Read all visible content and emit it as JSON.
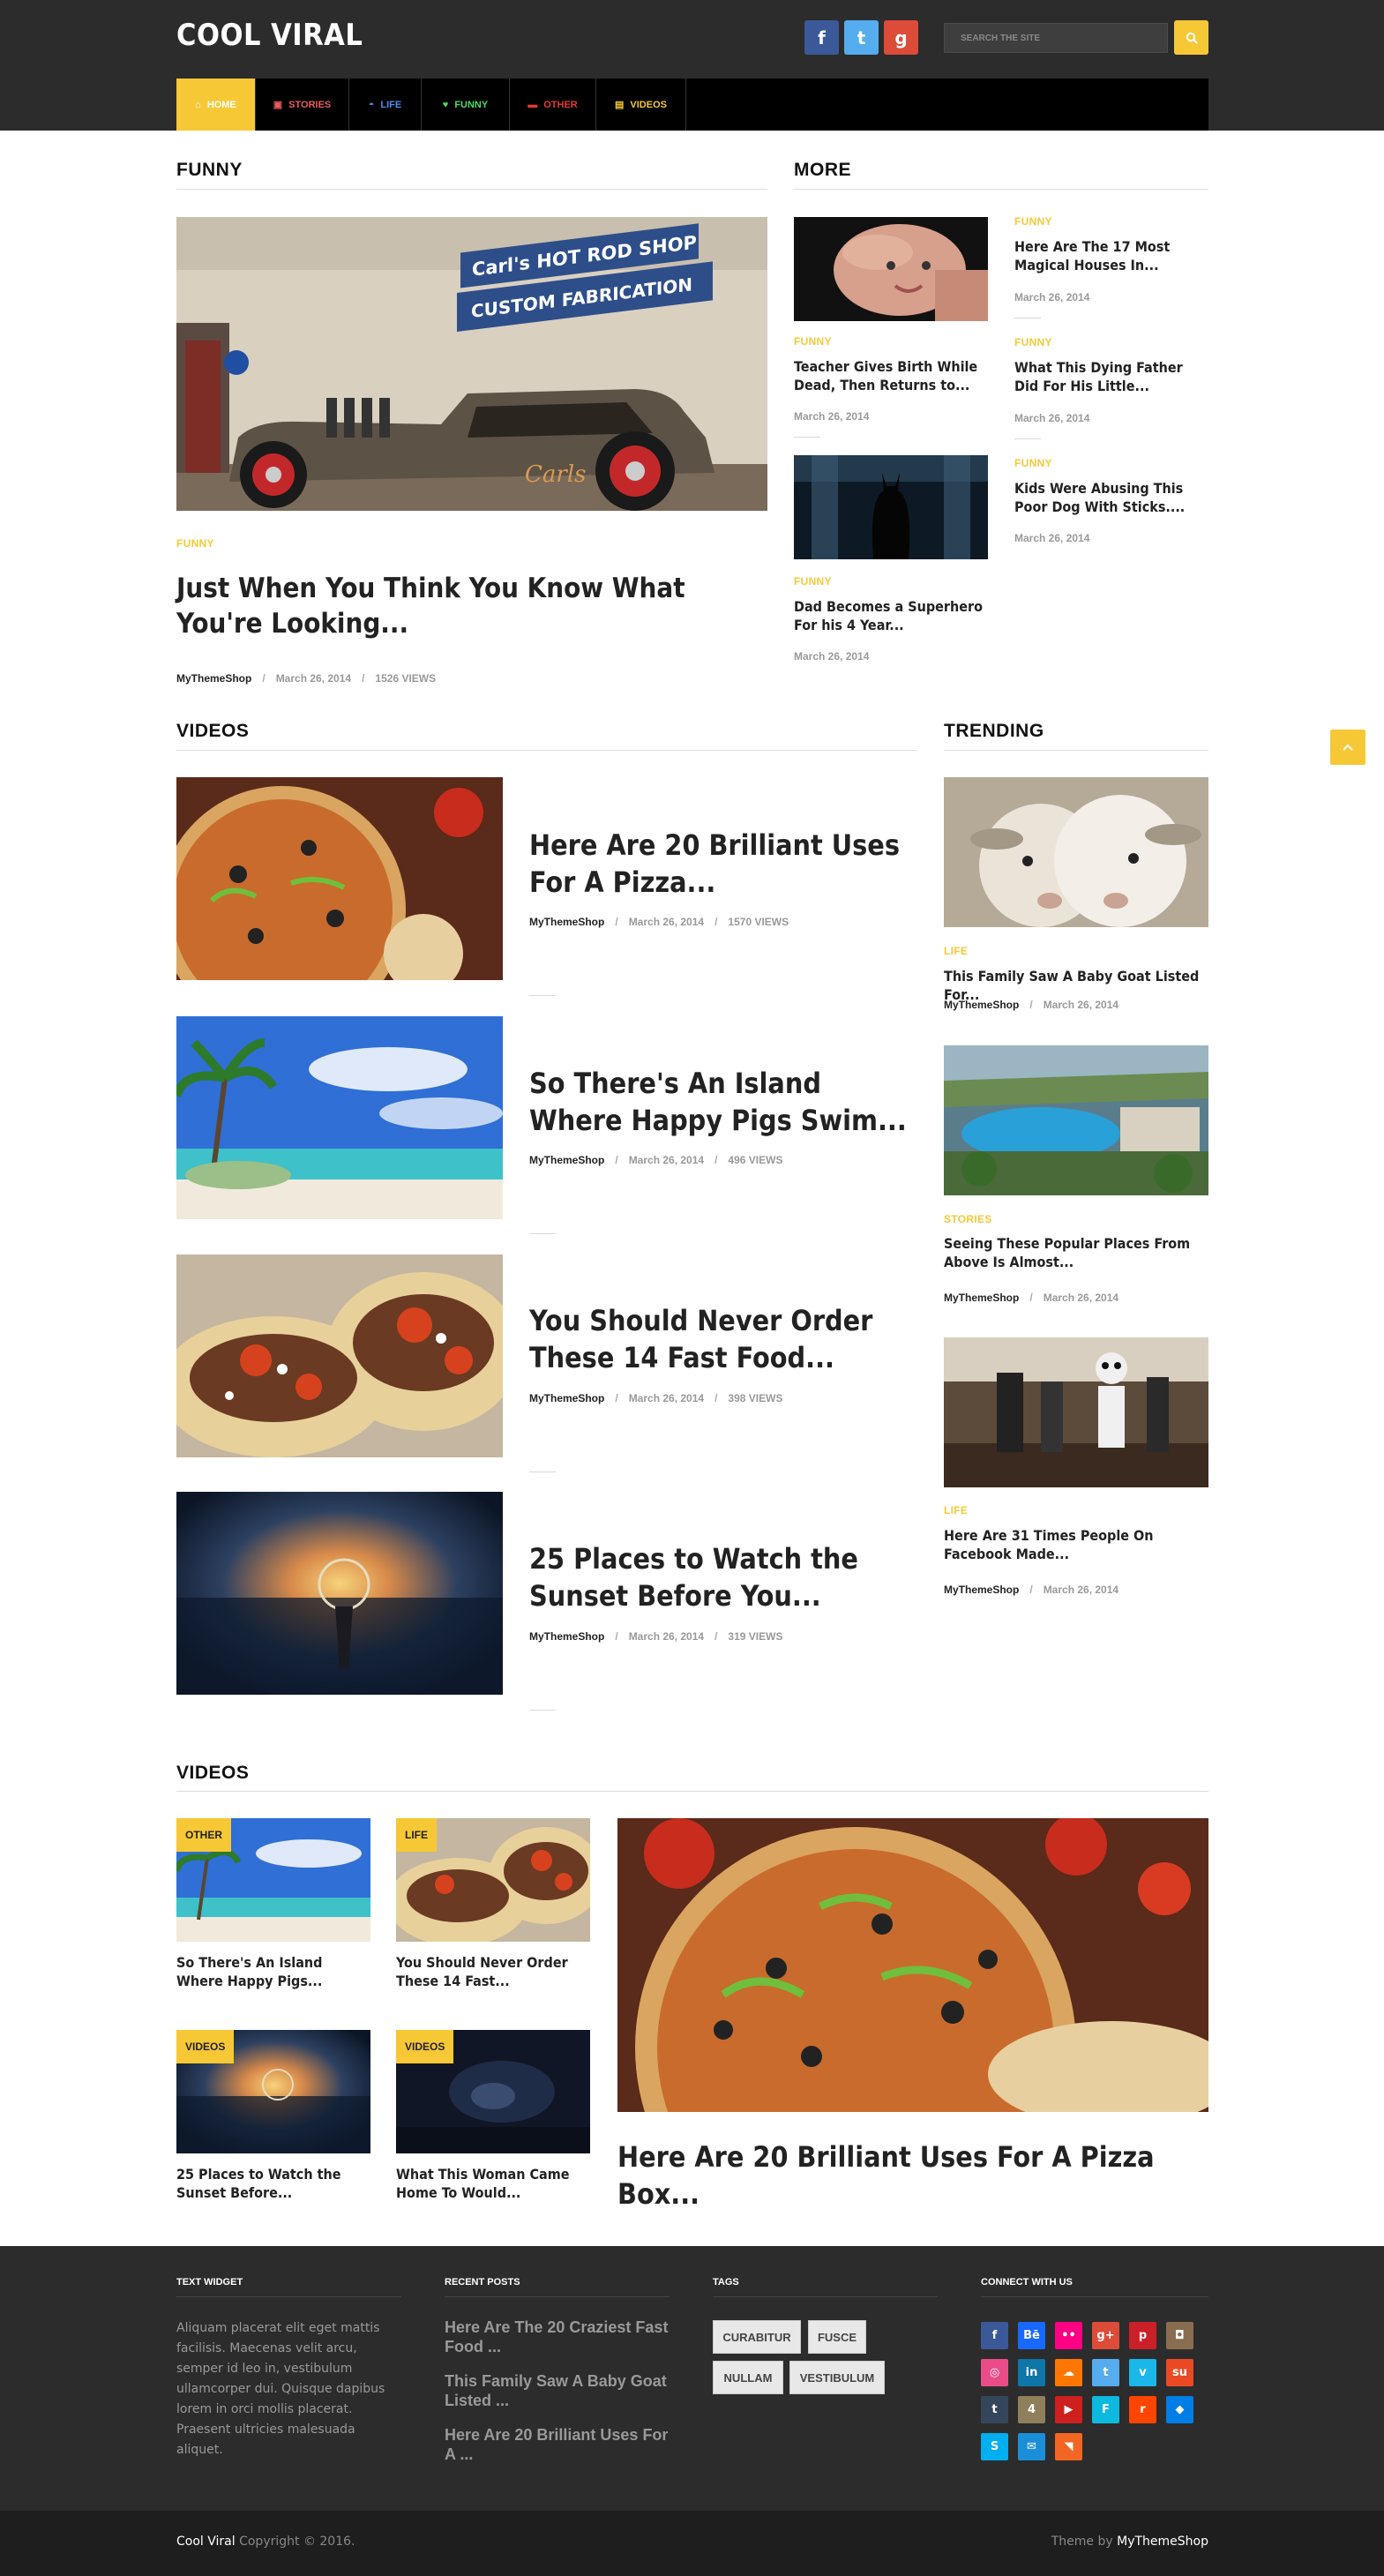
{
  "site": {
    "logo": "COOL VIRAL"
  },
  "header": {
    "social": [
      {
        "label": "f",
        "icon": "facebook-icon",
        "color": "#3b5998"
      },
      {
        "label": "t",
        "icon": "twitter-icon",
        "color": "#55acee"
      },
      {
        "label": "g",
        "icon": "google-plus-icon",
        "color": "#dd4b39"
      }
    ],
    "search_placeholder": "SEARCH THE SITE"
  },
  "nav": [
    {
      "label": "HOME",
      "icon": "home-icon",
      "color": "#ffffff"
    },
    {
      "label": "STORIES",
      "icon": "picture-icon",
      "color": "#e85c5c"
    },
    {
      "label": "LIFE",
      "icon": "car-icon",
      "color": "#4f8df0"
    },
    {
      "label": "FUNNY",
      "icon": "heart-icon",
      "color": "#4cd964"
    },
    {
      "label": "OTHER",
      "icon": "bookmark-icon",
      "color": "#e53935"
    },
    {
      "label": "VIDEOS",
      "icon": "film-icon",
      "color": "#f7c836"
    }
  ],
  "funny": {
    "heading": "FUNNY",
    "feature": {
      "sign_line1": "Carl's HOT ROD SHOP",
      "sign_line2": "CUSTOM FABRICATION",
      "car_text": "Carls",
      "category": "FUNNY",
      "title": "Just When You Think You Know What You're Looking...",
      "author": "MyThemeShop",
      "date": "March 26, 2014",
      "views": "1526 VIEWS"
    }
  },
  "more": {
    "heading": "MORE",
    "items": [
      {
        "category": "FUNNY",
        "title": "Here Are The 17 Most Magical Houses In...",
        "date": "March 26, 2014"
      },
      {
        "category": "FUNNY",
        "title": "Teacher Gives Birth While Dead, Then Returns to...",
        "date": "March 26, 2014"
      },
      {
        "category": "FUNNY",
        "title": "What This Dying Father Did For His Little...",
        "date": "March 26, 2014"
      },
      {
        "category": "FUNNY",
        "title": "Kids Were Abusing This Poor Dog With Sticks....",
        "date": "March 26, 2014"
      },
      {
        "category": "FUNNY",
        "title": "Dad Becomes a Superhero For his 4 Year...",
        "date": "March 26, 2014"
      }
    ]
  },
  "videos": {
    "heading": "VIDEOS",
    "items": [
      {
        "title": "Here Are 20 Brilliant Uses For A Pizza...",
        "author": "MyThemeShop",
        "date": "March 26, 2014",
        "views": "1570 VIEWS"
      },
      {
        "title": "So There's An Island Where Happy Pigs Swim...",
        "author": "MyThemeShop",
        "date": "March 26, 2014",
        "views": "496 VIEWS"
      },
      {
        "title": "You Should Never Order These 14 Fast Food...",
        "author": "MyThemeShop",
        "date": "March 26, 2014",
        "views": "398 VIEWS"
      },
      {
        "title": "25 Places to Watch the Sunset Before You...",
        "author": "MyThemeShop",
        "date": "March 26, 2014",
        "views": "319 VIEWS"
      }
    ]
  },
  "trending": {
    "heading": "TRENDING",
    "items": [
      {
        "category": "LIFE",
        "title": "This Family Saw A Baby Goat Listed For...",
        "author": "MyThemeShop",
        "date": "March 26, 2014"
      },
      {
        "category": "STORIES",
        "title": "Seeing These Popular Places From Above Is Almost...",
        "author": "MyThemeShop",
        "date": "March 26, 2014"
      },
      {
        "category": "LIFE",
        "title": "Here Are 31 Times People On Facebook Made...",
        "author": "MyThemeShop",
        "date": "March 26, 2014"
      }
    ]
  },
  "videos2": {
    "heading": "VIDEOS",
    "grid": [
      {
        "badge": "OTHER",
        "title": "So There's An Island Where Happy Pigs..."
      },
      {
        "badge": "LIFE",
        "title": "You Should Never Order These 14 Fast..."
      },
      {
        "badge": "VIDEOS",
        "title": "25 Places to Watch the Sunset Before..."
      },
      {
        "badge": "VIDEOS",
        "title": "What This Woman Came Home To Would..."
      }
    ],
    "big_title": "Here Are 20 Brilliant Uses For A Pizza Box..."
  },
  "footer": {
    "text_widget": {
      "heading": "TEXT WIDGET",
      "body": "Aliquam placerat elit eget mattis facilisis. Maecenas velit arcu, semper id leo in, vestibulum ullamcorper dui. Quisque dapibus lorem in orci mollis placerat. Praesent ultricies malesuada aliquet."
    },
    "recent": {
      "heading": "RECENT POSTS",
      "items": [
        "Here Are The 20 Craziest Fast Food ...",
        "This Family Saw A Baby Goat Listed ...",
        "Here Are 20 Brilliant Uses For A ..."
      ]
    },
    "tags": {
      "heading": "TAGS",
      "items": [
        "CURABITUR",
        "FUSCE",
        "NULLAM",
        "VESTIBULUM"
      ]
    },
    "connect": {
      "heading": "CONNECT WITH US",
      "icons": [
        {
          "name": "facebook-icon",
          "label": "f",
          "color": "#3b5998"
        },
        {
          "name": "behance-icon",
          "label": "Bē",
          "color": "#1769ff"
        },
        {
          "name": "flickr-icon",
          "label": "••",
          "color": "#ff0084"
        },
        {
          "name": "google-plus-icon",
          "label": "g+",
          "color": "#dd4b39"
        },
        {
          "name": "pinterest-icon",
          "label": "p",
          "color": "#cb2027"
        },
        {
          "name": "instagram-icon",
          "label": "◘",
          "color": "#8a6d50"
        },
        {
          "name": "dribbble-icon",
          "label": "◎",
          "color": "#ea4c89"
        },
        {
          "name": "linkedin-icon",
          "label": "in",
          "color": "#0e76a8"
        },
        {
          "name": "soundcloud-icon",
          "label": "☁",
          "color": "#ff7700"
        },
        {
          "name": "twitter-icon",
          "label": "t",
          "color": "#55acee"
        },
        {
          "name": "vimeo-icon",
          "label": "v",
          "color": "#1ab7ea"
        },
        {
          "name": "stumbleupon-icon",
          "label": "su",
          "color": "#eb4924"
        },
        {
          "name": "tumblr-icon",
          "label": "t",
          "color": "#35465c"
        },
        {
          "name": "foursquare-icon",
          "label": "4",
          "color": "#8f7f5c"
        },
        {
          "name": "youtube-icon",
          "label": "▶",
          "color": "#cd201f"
        },
        {
          "name": "foursquare-alt-icon",
          "label": "F",
          "color": "#0cbadf"
        },
        {
          "name": "reddit-icon",
          "label": "r",
          "color": "#ff4500"
        },
        {
          "name": "dropbox-icon",
          "label": "◆",
          "color": "#007ee5"
        },
        {
          "name": "skype-icon",
          "label": "S",
          "color": "#00aff0"
        },
        {
          "name": "email-icon",
          "label": "✉",
          "color": "#1a8fd8"
        },
        {
          "name": "rss-icon",
          "label": "◥",
          "color": "#f26522"
        }
      ]
    },
    "copyright_site": "Cool Viral",
    "copyright_text": "Copyright © 2016.",
    "theme_by": "Theme by",
    "theme_author": "MyThemeShop"
  }
}
